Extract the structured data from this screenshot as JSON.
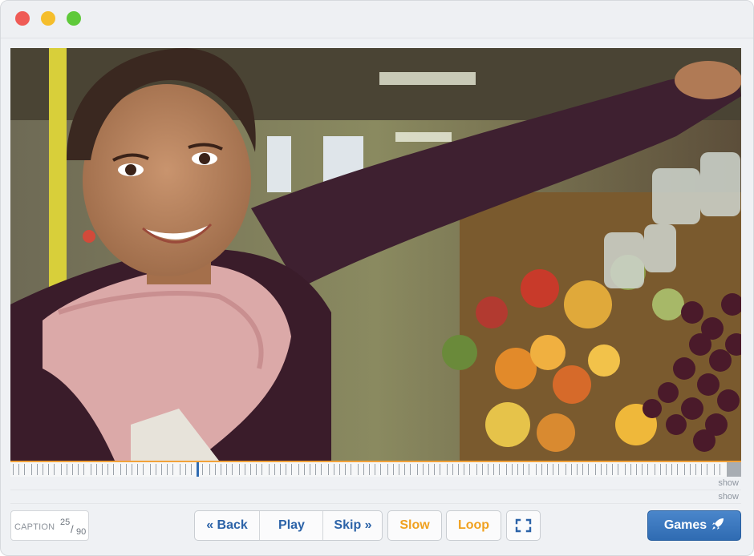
{
  "window": {
    "controls": [
      "close",
      "minimize",
      "zoom"
    ]
  },
  "video": {
    "icon": "video-frame"
  },
  "timeline": {
    "accent_color": "#f2a23a",
    "playhead_color": "#2f6bb2",
    "progress": 0.255
  },
  "rows": [
    {
      "label": "show"
    },
    {
      "label": "show"
    }
  ],
  "caption": {
    "label": "CAPTION",
    "current": "25",
    "slash": "/",
    "total": "90"
  },
  "controls": {
    "back_label": "« Back",
    "play_label": "Play",
    "skip_label": "Skip »",
    "slow_label": "Slow",
    "loop_label": "Loop",
    "fullscreen_icon": "fullscreen-icon"
  },
  "games": {
    "label": "Games",
    "icon": "rocket-icon"
  },
  "colors": {
    "blue_text": "#2c63a8",
    "orange_text": "#f0a11f",
    "games_bg": "#3a78c0"
  }
}
